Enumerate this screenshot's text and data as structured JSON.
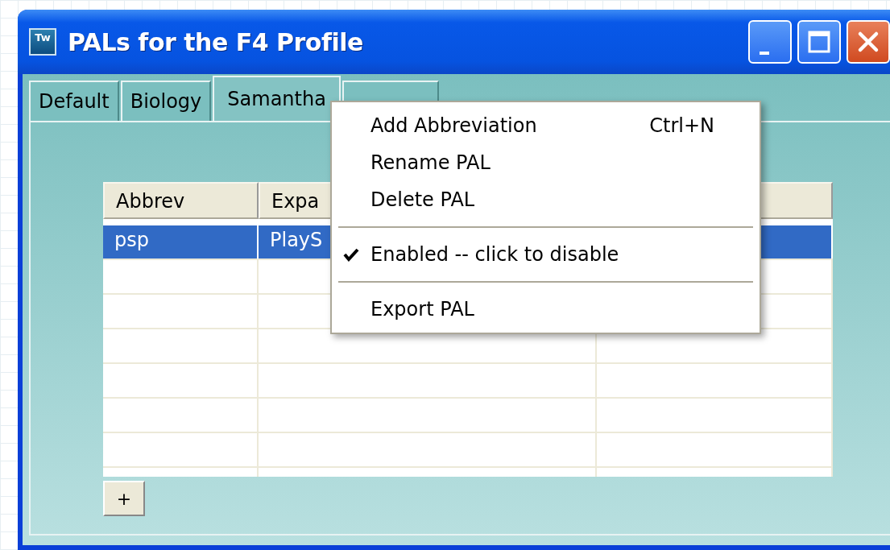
{
  "window": {
    "title": "PALs for the F4 Profile",
    "app_icon_text": "Tw"
  },
  "tabs": [
    {
      "label": "Default",
      "selected": false
    },
    {
      "label": "Biology",
      "selected": false
    },
    {
      "label": "Samantha",
      "selected": true
    },
    {
      "selected": false
    }
  ],
  "table": {
    "columns": [
      "Abbrev",
      "Expa"
    ],
    "rows": [
      {
        "cells": [
          "psp",
          "PlayS"
        ],
        "selected": true
      }
    ]
  },
  "add_button": {
    "label": "+"
  },
  "context_menu": {
    "items": [
      {
        "kind": "item",
        "label": "Add Abbreviation",
        "shortcut": "Ctrl+N",
        "checked": false
      },
      {
        "kind": "item",
        "label": "Rename PAL",
        "checked": false
      },
      {
        "kind": "item",
        "label": "Delete PAL",
        "checked": false
      },
      {
        "kind": "separator"
      },
      {
        "kind": "item",
        "label": "Enabled -- click to disable",
        "checked": true
      },
      {
        "kind": "separator"
      },
      {
        "kind": "item",
        "label": "Export PAL",
        "checked": false
      }
    ]
  }
}
